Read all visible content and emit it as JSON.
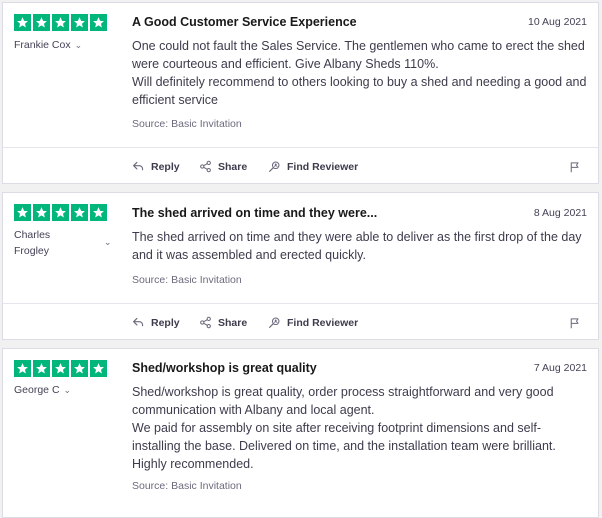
{
  "brand_color": "#00b67a",
  "reviews": [
    {
      "stars": 5,
      "author": "Frankie Cox",
      "author_lines": [
        "Frankie Cox"
      ],
      "title": "A Good Customer Service Experience",
      "date": "10 Aug 2021",
      "body": [
        "One could not fault the Sales Service. The gentlemen who came to erect the shed were courteous and efficient. Give Albany Sheds 110%.",
        "Will definitely recommend to others looking to buy a shed and needing a good and efficient service"
      ],
      "source": "Source: Basic Invitation"
    },
    {
      "stars": 5,
      "author": "Charles Frogley",
      "author_lines": [
        "Charles",
        "Frogley"
      ],
      "title": "The shed arrived on time and they were...",
      "date": "8 Aug 2021",
      "body": [
        "The shed arrived on time and they were able to deliver as the first drop of the day and it was assembled and erected quickly."
      ],
      "source": "Source: Basic Invitation"
    },
    {
      "stars": 5,
      "author": "George C",
      "author_lines": [
        "George C"
      ],
      "title": "Shed/workshop is great quality",
      "date": "7 Aug 2021",
      "body": [
        "Shed/workshop is great quality, order process straightforward and very good communication with Albany and local agent.",
        "We paid for assembly on site after receiving footprint dimensions and self-installing the base. Delivered on time, and the installation team were brilliant.",
        "Highly recommended."
      ],
      "source": "Source: Basic Invitation"
    }
  ],
  "actions": {
    "reply": "Reply",
    "share": "Share",
    "find_reviewer": "Find Reviewer"
  },
  "icons": {
    "star": "star-icon",
    "chevron": "chevron-down-icon",
    "reply": "reply-icon",
    "share": "share-icon",
    "find_reviewer": "find-reviewer-icon",
    "flag": "flag-icon"
  }
}
